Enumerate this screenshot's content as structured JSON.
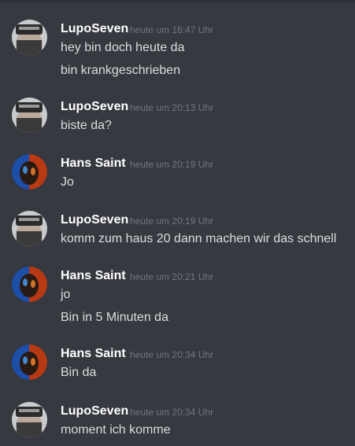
{
  "colors": {
    "background": "#36393f",
    "username": "#ffffff",
    "message_text": "#dcddde",
    "timestamp": "#72767d"
  },
  "messages": [
    {
      "author": "LupoSeven",
      "avatar": "lupo-avatar",
      "timestamp": "heute um 16:47 Uhr",
      "lines": [
        "hey bin doch heute da",
        "bin krankgeschrieben"
      ]
    },
    {
      "author": "LupoSeven",
      "avatar": "lupo-avatar",
      "timestamp": "heute um 20:13 Uhr",
      "lines": [
        "biste da?"
      ]
    },
    {
      "author": "Hans Saint",
      "avatar": "hans-avatar",
      "timestamp": "heute um 20:19 Uhr",
      "lines": [
        "Jo"
      ]
    },
    {
      "author": "LupoSeven",
      "avatar": "lupo-avatar",
      "timestamp": "heute um 20:19 Uhr",
      "lines": [
        "komm zum haus 20 dann machen wir das schnell"
      ]
    },
    {
      "author": "Hans Saint",
      "avatar": "hans-avatar",
      "timestamp": "heute um 20:21 Uhr",
      "lines": [
        "jo",
        "Bin in 5 Minuten da"
      ]
    },
    {
      "author": "Hans Saint",
      "avatar": "hans-avatar",
      "timestamp": "heute um 20:34 Uhr",
      "lines": [
        "Bin da"
      ]
    },
    {
      "author": "LupoSeven",
      "avatar": "lupo-avatar",
      "timestamp": "heute um 20:34 Uhr",
      "lines": [
        "moment ich komme"
      ]
    }
  ]
}
